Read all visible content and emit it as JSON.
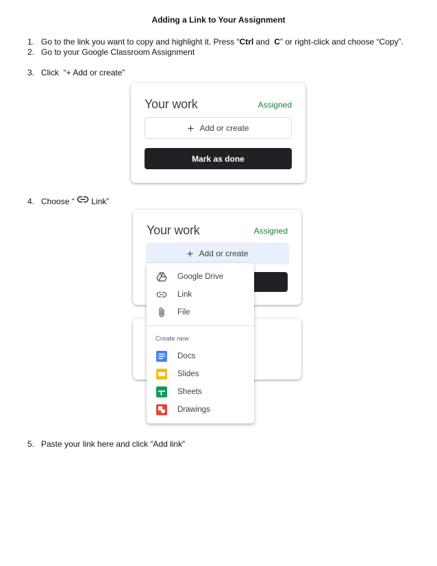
{
  "doc": {
    "title": "Adding a Link to Your Assignment",
    "steps": [
      {
        "num": "1.",
        "pre": "Go to the link you want to copy and highlight it. Press “",
        "b1": "Ctrl",
        "mid": " and  ",
        "b2": "C",
        "post": "” or right-click and choose “Copy”."
      },
      {
        "num": "2.",
        "text": "Go to your Google Classroom Assignment"
      },
      {
        "num": "3.",
        "text": "Click  “+ Add or create”"
      },
      {
        "num": "4.",
        "pre": "Choose “ ",
        "post": " Link”"
      },
      {
        "num": "5.",
        "text": "Paste your link here and click “Add link”"
      }
    ]
  },
  "card1": {
    "title": "Your work",
    "status": "Assigned",
    "add_icon": "plus-icon",
    "add_label": "Add or create",
    "done_label": "Mark as done",
    "status_color": "#188038",
    "done_bg": "#202124"
  },
  "card2": {
    "title": "Your work",
    "status": "Assigned",
    "add_label": "Add or create",
    "add_bg": "#e8f0fe"
  },
  "menu": {
    "items": [
      {
        "icon": "google-drive-icon",
        "label": "Google Drive"
      },
      {
        "icon": "link-icon",
        "label": "Link"
      },
      {
        "icon": "paperclip-icon",
        "label": "File"
      }
    ],
    "section": "Create new",
    "create": [
      {
        "icon": "docs-icon",
        "label": "Docs",
        "color": "#4285f4"
      },
      {
        "icon": "slides-icon",
        "label": "Slides",
        "color": "#fbbc04"
      },
      {
        "icon": "sheets-icon",
        "label": "Sheets",
        "color": "#0f9d58"
      },
      {
        "icon": "drawings-icon",
        "label": "Drawings",
        "color": "#ea4335"
      }
    ]
  }
}
